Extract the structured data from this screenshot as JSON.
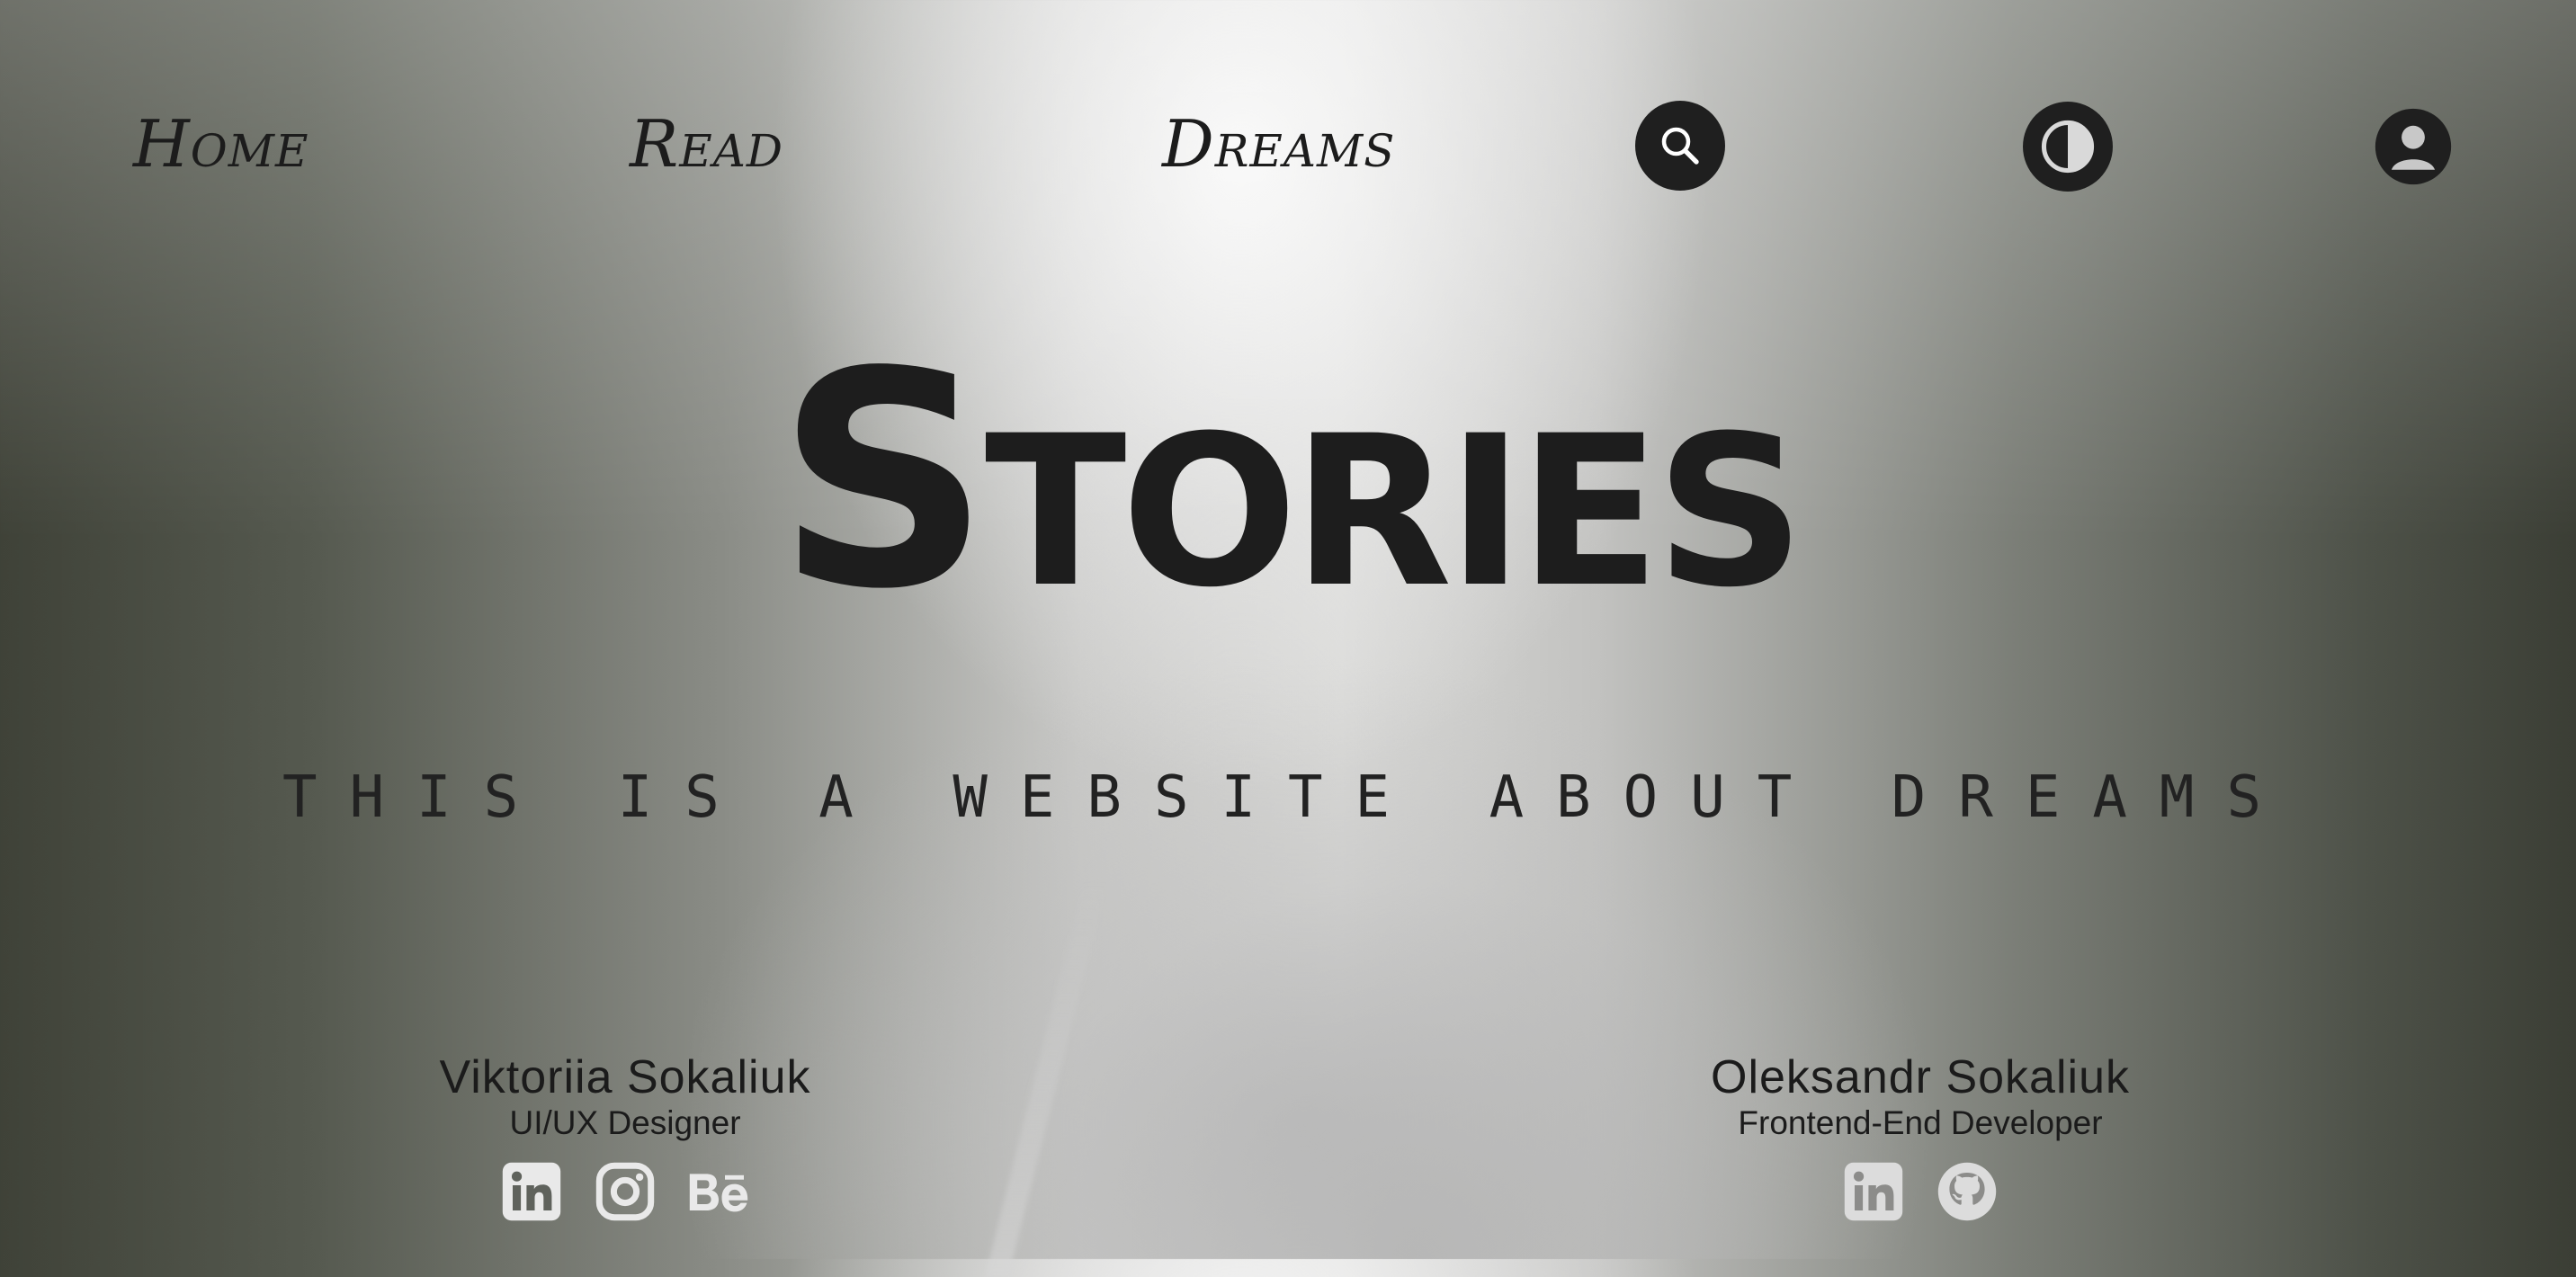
{
  "nav": {
    "home_label": "Home",
    "read_label": "Read",
    "dreams_label": "Dreams",
    "search_icon": "search-icon",
    "theme_icon": "contrast-icon",
    "profile_icon": "user-circle-icon"
  },
  "hero": {
    "title": "Stories",
    "subtitle": "This is a website about dreams"
  },
  "authors": [
    {
      "name": "Viktoriia Sokaliuk",
      "role": "UI/UX Designer",
      "socials": [
        "linkedin-icon",
        "instagram-icon",
        "behance-icon"
      ]
    },
    {
      "name": "Oleksandr Sokaliuk",
      "role": "Frontend-End Developer",
      "socials": [
        "linkedin-icon",
        "github-icon"
      ]
    }
  ],
  "colors": {
    "ink": "#1d1d1d",
    "social_icon": "#e9e9e9"
  }
}
